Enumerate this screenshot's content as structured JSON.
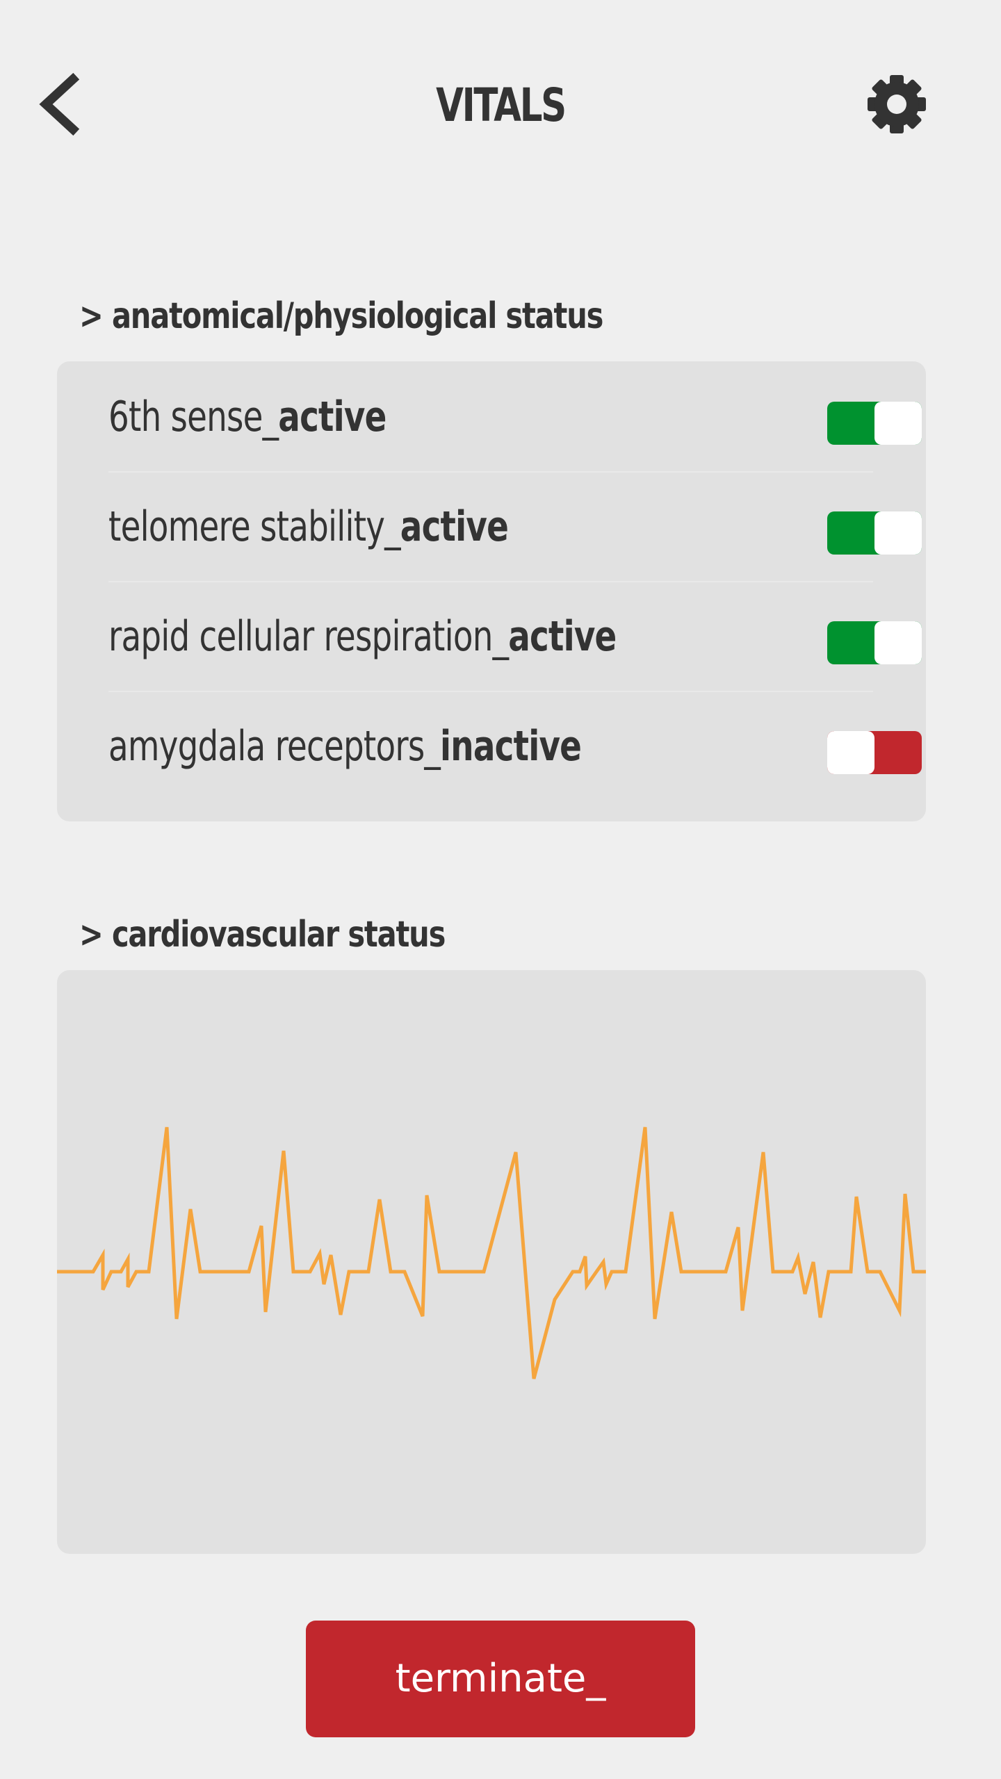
{
  "header": {
    "title": "VITALS",
    "back_icon": "chevron-left-icon",
    "settings_icon": "gear-icon"
  },
  "anatomical": {
    "heading": "> anatomical/physiological status",
    "items": [
      {
        "label": "6th sense_",
        "state": "active",
        "on": true
      },
      {
        "label": "telomere stability_",
        "state": "active",
        "on": true
      },
      {
        "label": "rapid cellular respiration_",
        "state": "active",
        "on": true
      },
      {
        "label": "amygdala receptors_",
        "state": "inactive",
        "on": false
      }
    ]
  },
  "cardiovascular": {
    "heading": "> cardiovascular status",
    "line_color": "#f5a53e"
  },
  "actions": {
    "terminate_label": "terminate_"
  },
  "colors": {
    "background": "#efefef",
    "card": "#e1e1e1",
    "text": "#333333",
    "toggle_on": "#00922f",
    "toggle_off": "#c1272d",
    "button": "#c1272d"
  }
}
